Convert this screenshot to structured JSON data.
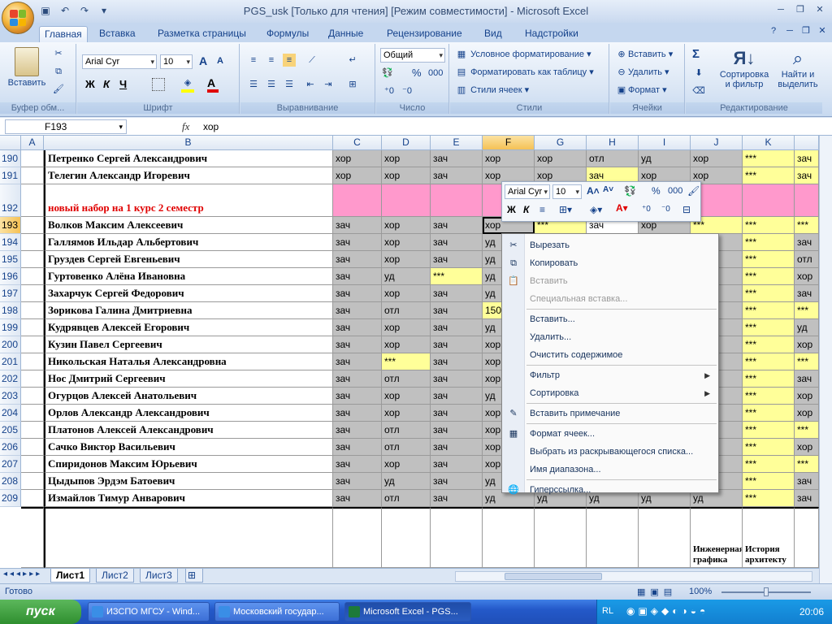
{
  "window": {
    "title": "PGS_usk  [Только для чтения]  [Режим совместимости] - Microsoft Excel"
  },
  "tabs": [
    "Главная",
    "Вставка",
    "Разметка страницы",
    "Формулы",
    "Данные",
    "Рецензирование",
    "Вид",
    "Надстройки"
  ],
  "ribbon": {
    "clipboard": {
      "label": "Буфер обм...",
      "paste": "Вставить"
    },
    "font": {
      "label": "Шрифт",
      "name": "Arial Cyr",
      "size": "10",
      "bold": "Ж",
      "italic": "К",
      "underline": "Ч",
      "grow": "A",
      "shrink": "A"
    },
    "alignment": {
      "label": "Выравнивание"
    },
    "number": {
      "label": "Число",
      "format": "Общий",
      "percent": "%",
      "thousands": "000"
    },
    "styles": {
      "label": "Стили",
      "cond": "Условное форматирование",
      "table": "Форматировать как таблицу",
      "cellstyles": "Стили ячеек"
    },
    "cells": {
      "label": "Ячейки",
      "insert": "Вставить",
      "delete": "Удалить",
      "format": "Формат"
    },
    "editing": {
      "label": "Редактирование",
      "sum": "Σ",
      "sort": "Сортировка и фильтр",
      "find": "Найти и выделить"
    }
  },
  "formula_bar": {
    "name_box": "F193",
    "fx": "fx",
    "value": "хор"
  },
  "columns": [
    "A",
    "B",
    "C",
    "D",
    "E",
    "F",
    "G",
    "H",
    "I",
    "J",
    "K",
    ""
  ],
  "rows": [
    {
      "n": "190",
      "name": "Петренко Сергей Александрович",
      "cells": [
        "хор",
        "хор",
        "зач",
        "хор",
        "хор",
        "отл",
        "уд",
        "хор",
        "***",
        "зач"
      ]
    },
    {
      "n": "191",
      "name": "Телегин Александр Игоревич",
      "cells": [
        "хор",
        "хор",
        "зач",
        "хор",
        "хор",
        "зач",
        "хор",
        "хор",
        "***",
        "зач"
      ]
    },
    {
      "n": "192",
      "name": "новый набор на 1 курс 2 семестр",
      "cells": [
        "",
        "",
        "",
        "",
        "",
        "",
        "",
        "",
        "",
        ""
      ]
    },
    {
      "n": "193",
      "name": "Волков Максим Алексеевич",
      "cells": [
        "зач",
        "хор",
        "зач",
        "хор",
        "***",
        "зач",
        "хор",
        "***",
        "***",
        "***"
      ]
    },
    {
      "n": "194",
      "name": "Галлямов Ильдар Альбертович",
      "cells": [
        "зач",
        "хор",
        "зач",
        "уд",
        "",
        "",
        "",
        "",
        "***",
        "зач"
      ]
    },
    {
      "n": "195",
      "name": "Груздев Сергей Евгеньевич",
      "cells": [
        "зач",
        "хор",
        "зач",
        "уд",
        "",
        "",
        "",
        "",
        "***",
        "отл"
      ]
    },
    {
      "n": "196",
      "name": "Гуртовенко Алёна Ивановна",
      "cells": [
        "зач",
        "уд",
        "***",
        "уд",
        "",
        "",
        "",
        "",
        "***",
        "хор"
      ]
    },
    {
      "n": "197",
      "name": "Захарчук Сергей Федорович",
      "cells": [
        "зач",
        "хор",
        "зач",
        "уд",
        "",
        "",
        "",
        "",
        "***",
        "зач"
      ]
    },
    {
      "n": "198",
      "name": "Зорикова Галина Дмитриевна",
      "cells": [
        "зач",
        "отл",
        "зач",
        "150",
        "",
        "",
        "",
        "",
        "***",
        "***"
      ]
    },
    {
      "n": "199",
      "name": "Кудрявцев Алексей Егорович",
      "cells": [
        "зач",
        "хор",
        "зач",
        "уд",
        "",
        "",
        "",
        "",
        "***",
        "уд"
      ]
    },
    {
      "n": "200",
      "name": "Кузин Павел Сергеевич",
      "cells": [
        "зач",
        "хор",
        "зач",
        "хор",
        "",
        "",
        "",
        "",
        "***",
        "хор"
      ]
    },
    {
      "n": "201",
      "name": "Никольская Наталья Александровна",
      "cells": [
        "зач",
        "***",
        "зач",
        "хор",
        "",
        "",
        "",
        "",
        "***",
        "***"
      ]
    },
    {
      "n": "202",
      "name": "Нос Дмитрий Сергеевич",
      "cells": [
        "зач",
        "отл",
        "зач",
        "хор",
        "",
        "",
        "",
        "",
        "***",
        "зач"
      ]
    },
    {
      "n": "203",
      "name": "Огурцов Алексей Анатольевич",
      "cells": [
        "зач",
        "хор",
        "зач",
        "уд",
        "",
        "",
        "",
        "",
        "***",
        "хор"
      ]
    },
    {
      "n": "204",
      "name": "Орлов Александр Александрович",
      "cells": [
        "зач",
        "хор",
        "зач",
        "хор",
        "",
        "",
        "",
        "",
        "***",
        "хор"
      ]
    },
    {
      "n": "205",
      "name": "Платонов Алексей Александрович",
      "cells": [
        "зач",
        "отл",
        "зач",
        "хор",
        "",
        "",
        "",
        "",
        "***",
        "***"
      ]
    },
    {
      "n": "206",
      "name": "Сачко Виктор Васильевич",
      "cells": [
        "зач",
        "отл",
        "зач",
        "хор",
        "",
        "",
        "",
        "",
        "***",
        "хор"
      ]
    },
    {
      "n": "207",
      "name": "Спиридонов Максим Юрьевич",
      "cells": [
        "зач",
        "хор",
        "зач",
        "хор",
        "",
        "",
        "",
        "",
        "***",
        "***"
      ]
    },
    {
      "n": "208",
      "name": "Цыдыпов Эрдэм Батоевич",
      "cells": [
        "зач",
        "уд",
        "зач",
        "уд",
        "",
        "",
        "",
        "",
        "***",
        "зач"
      ]
    },
    {
      "n": "209",
      "name": "Измайлов Тимур Анварович",
      "cells": [
        "зач",
        "отл",
        "зач",
        "уд",
        "уд",
        "уд",
        "уд",
        "уд",
        "***",
        "зач"
      ]
    }
  ],
  "bottom_headers": {
    "J": "Инженерная графика",
    "K": "История архитекту"
  },
  "mini_toolbar": {
    "font": "Arial Cyr",
    "size": "10",
    "bold": "Ж",
    "italic": "К",
    "percent": "%",
    "thousands": "000"
  },
  "context_menu": [
    {
      "label": "Вырезать",
      "icon": "scissors-icon",
      "disabled": false
    },
    {
      "label": "Копировать",
      "icon": "copy-icon",
      "disabled": false
    },
    {
      "label": "Вставить",
      "icon": "paste-icon",
      "disabled": true
    },
    {
      "label": "Специальная вставка...",
      "icon": "",
      "disabled": true
    },
    {
      "sep": true
    },
    {
      "label": "Вставить...",
      "icon": "",
      "disabled": false
    },
    {
      "label": "Удалить...",
      "icon": "",
      "disabled": false
    },
    {
      "label": "Очистить содержимое",
      "icon": "",
      "disabled": false
    },
    {
      "sep": true
    },
    {
      "label": "Фильтр",
      "icon": "",
      "disabled": false,
      "submenu": true
    },
    {
      "label": "Сортировка",
      "icon": "",
      "disabled": false,
      "submenu": true
    },
    {
      "sep": true
    },
    {
      "label": "Вставить примечание",
      "icon": "comment-icon",
      "disabled": false
    },
    {
      "sep": true
    },
    {
      "label": "Формат ячеек...",
      "icon": "format-cells-icon",
      "disabled": false
    },
    {
      "label": "Выбрать из раскрывающегося списка...",
      "icon": "",
      "disabled": false
    },
    {
      "label": "Имя диапазона...",
      "icon": "",
      "disabled": false
    },
    {
      "sep": true
    },
    {
      "label": "Гиперссылка...",
      "icon": "hyperlink-icon",
      "disabled": false
    }
  ],
  "sheets": [
    "Лист1",
    "Лист2",
    "Лист3"
  ],
  "status": {
    "ready": "Готово",
    "zoom": "100%"
  },
  "taskbar": {
    "start": "пуск",
    "tasks": [
      "ИЗСПО МГСУ - Wind...",
      "Московский государ...",
      "Microsoft Excel - PGS..."
    ],
    "lang": "RL",
    "clock": "20:06"
  },
  "colors": {
    "gray": "#c0c0c0",
    "yellow": "#ffff99",
    "pink": "#ff99cc",
    "red": "#e00000"
  }
}
